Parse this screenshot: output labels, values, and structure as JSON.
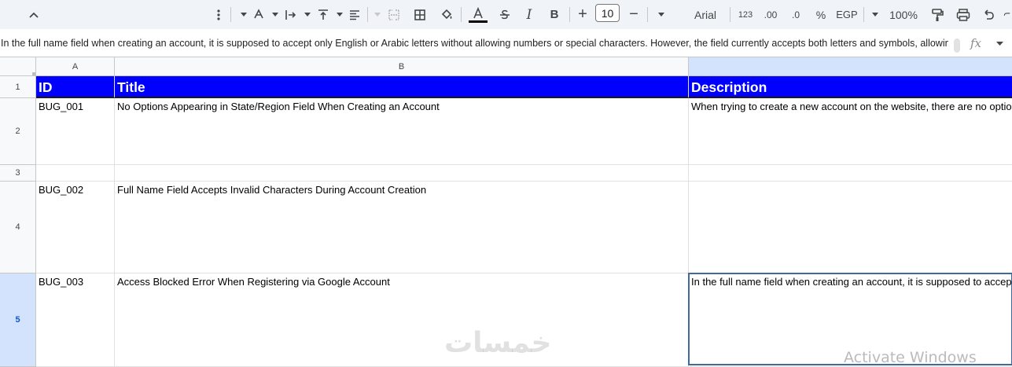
{
  "toolbar": {
    "font_size": "10",
    "font_name": "Arial",
    "number_format": "123",
    "decimal_increase": ".00",
    "decimal_decrease": ".0",
    "percent": "%",
    "currency": "EGP",
    "zoom": "100%"
  },
  "formula_bar": {
    "content": "In the full name field when creating an account, it is supposed to accept only English or Arabic letters without allowing numbers or special characters. However, the field currently accepts both letters and symbols, allowing",
    "fx_label": "fx"
  },
  "columns": [
    "A",
    "B"
  ],
  "rows": [
    "1",
    "2",
    "3",
    "4",
    "5"
  ],
  "header_row": {
    "id": "ID",
    "title": "Title",
    "description": "Description"
  },
  "bugs": [
    {
      "id": "BUG_001",
      "title": "No Options Appearing in State/Region Field When Creating an Account",
      "description": "When trying to create a new account on the website, there are no options available"
    },
    {
      "id": "BUG_002",
      "title": "Full Name Field Accepts Invalid Characters During Account Creation",
      "description": ""
    },
    {
      "id": "BUG_003",
      "title": "Access Blocked Error When Registering via Google Account",
      "description": "In the full name field when creating an account, it is supposed to accept only English or Arabic letters"
    }
  ],
  "watermarks": {
    "site": "خمسات",
    "os": "Activate Windows"
  },
  "colors": {
    "header_fill": "#0000ff",
    "header_text": "#ffffff",
    "selection": "#d3e3fd",
    "active_border": "#3d6b9c"
  }
}
